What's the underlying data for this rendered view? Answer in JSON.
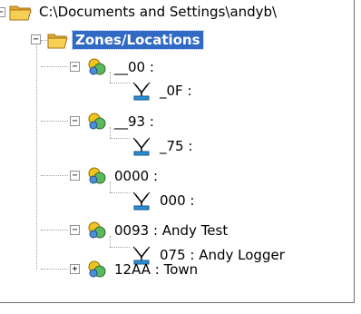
{
  "tree": {
    "root": {
      "label": "C:\\Documents and Settings\\andyb\\",
      "icon": "folder-open-icon"
    },
    "zones": {
      "label": "Zones/Locations",
      "icon": "folder-open-icon",
      "selected": true
    },
    "items": [
      {
        "zone": "__00  :",
        "logger": "_0F  :"
      },
      {
        "zone": "__93  :",
        "logger": "_75  :"
      },
      {
        "zone": "0000  :",
        "logger": "000  :"
      },
      {
        "zone": "0093  :  Andy Test",
        "logger": "075  :  Andy Logger"
      },
      {
        "zone": "12AA  :  Town",
        "collapsed": true
      }
    ]
  },
  "icons": {
    "zone": "zone-location-icon",
    "logger": "antenna-logger-icon",
    "expanded": "minus-box-icon",
    "collapsed": "plus-box-icon"
  },
  "colors": {
    "selection": "#316ac5",
    "folder": "#f2c23a",
    "zone": "#f0c020",
    "logger": "#2a8fd6"
  }
}
